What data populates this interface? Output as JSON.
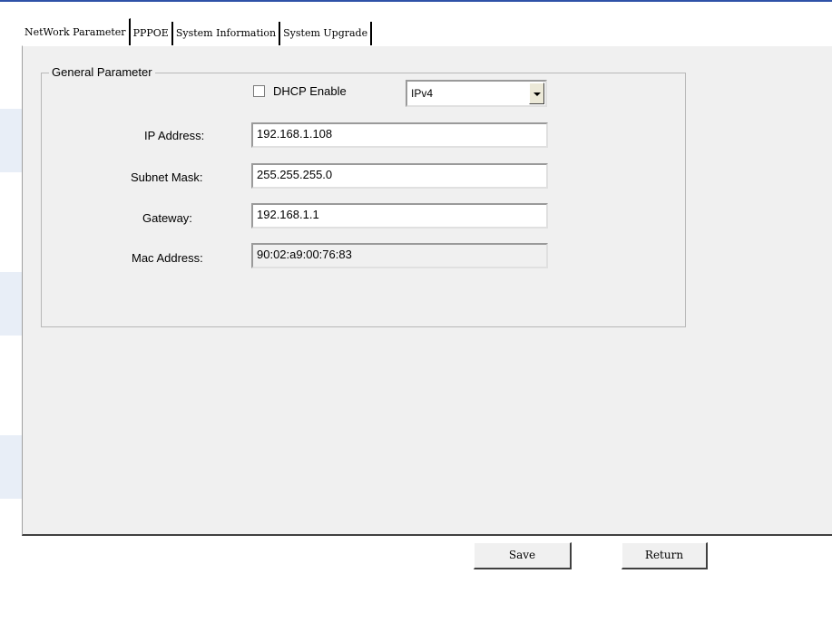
{
  "tabs": [
    {
      "label": "NetWork Parameter",
      "active": true
    },
    {
      "label": "PPPOE",
      "active": false
    },
    {
      "label": "System Information",
      "active": false
    },
    {
      "label": "System Upgrade",
      "active": false
    }
  ],
  "general": {
    "legend": "General Parameter",
    "dhcp_label": "DHCP Enable",
    "dhcp_checked": false,
    "ip_version": "IPv4"
  },
  "fields": {
    "ip_label": "IP Address:",
    "ip_value": "192.168.1.108",
    "subnet_label": "Subnet Mask:",
    "subnet_value": "255.255.255.0",
    "gateway_label": "Gateway:",
    "gateway_value": "192.168.1.1",
    "mac_label": "Mac Address:",
    "mac_value": "90:02:a9:00:76:83"
  },
  "buttons": {
    "save": "Save",
    "return": "Return"
  },
  "colors": {
    "accent": "#2f52a8",
    "panel": "#f0f0f0"
  }
}
